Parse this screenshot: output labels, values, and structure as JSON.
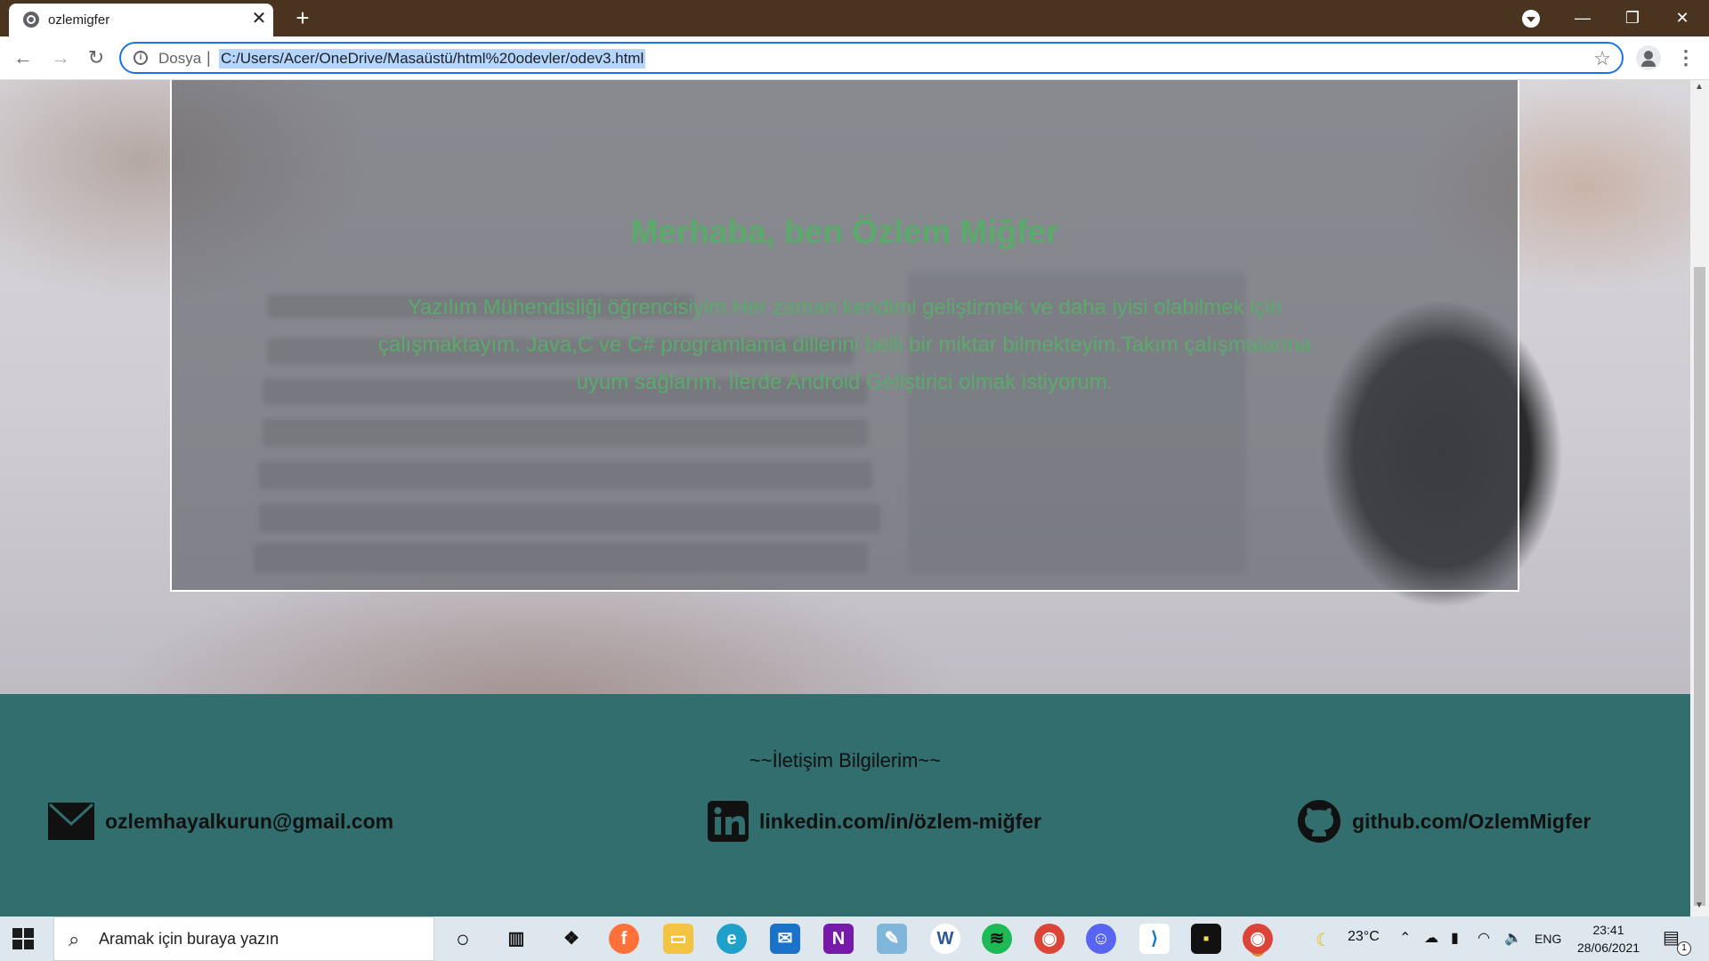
{
  "browser": {
    "tab_title": "ozlemigfer",
    "tab_close": "✕",
    "new_tab": "+",
    "omnibox": {
      "scheme_label": "Dosya",
      "separator": "|",
      "url": "C:/Users/Acer/OneDrive/Masaüstü/html%20odevler/odev3.html"
    },
    "window_controls": {
      "minimize": "—",
      "restore": "❐",
      "close": "✕"
    }
  },
  "page": {
    "heading": "Merhaba, ben Özlem Miğfer",
    "intro": "Yazılım Mühendisliği öğrencisiyim.Her zaman kendimi geliştirmek ve daha iyisi olabilmek için çalışmaktayım. Java,C ve C# programlama dillerini belli bir miktar bilmekteyim.Takım çalışmalarına uyum sağlarım. İlerde Android Geliştirici olmak istiyorum.",
    "text_color": "#5aab6b",
    "footer": {
      "title": "~~İletişim Bilgilerim~~",
      "background": "#326e6e",
      "contacts": [
        {
          "icon": "mail-icon",
          "text": "ozlemhayalkurun@gmail.com"
        },
        {
          "icon": "linkedin-icon",
          "text": "linkedin.com/in/özlem-miğfer"
        },
        {
          "icon": "github-icon",
          "text": "github.com/OzlemMigfer"
        }
      ]
    }
  },
  "taskbar": {
    "search_placeholder": "Aramak için buraya yazın",
    "weather": "23°C",
    "language": "ENG",
    "time": "23:41",
    "date": "28/06/2021",
    "notification_count": "1",
    "apps": [
      "cortana-icon",
      "task-view-icon",
      "dropbox-icon",
      "firefox-icon",
      "file-explorer-icon",
      "edge-icon",
      "mail-icon",
      "onenote-icon",
      "notepad-icon",
      "word-icon",
      "spotify-icon",
      "chrome-icon",
      "discord-icon",
      "vscode-icon",
      "sticky-notes-icon",
      "chrome-active-icon"
    ]
  }
}
